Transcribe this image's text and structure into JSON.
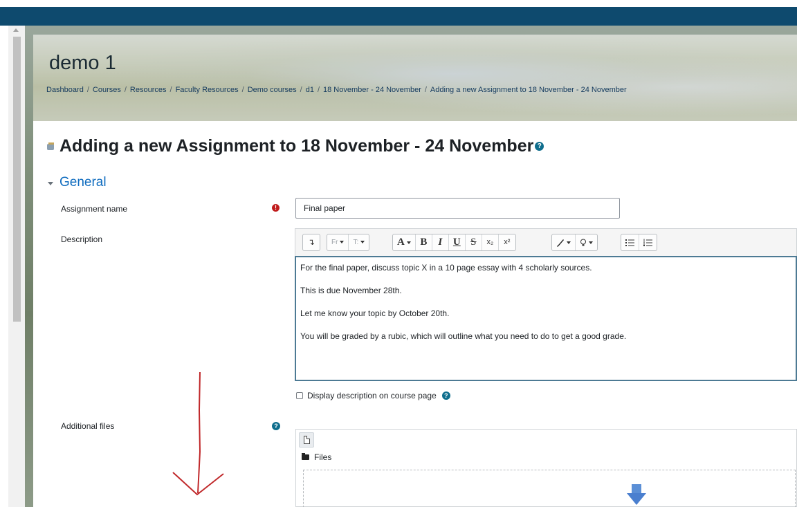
{
  "course": {
    "title": "demo 1"
  },
  "breadcrumb": [
    "Dashboard",
    "Courses",
    "Resources",
    "Faculty Resources",
    "Demo courses",
    "d1",
    "18 November - 24 November",
    "Adding a new Assignment to 18 November - 24 November"
  ],
  "page": {
    "heading": "Adding a new Assignment to 18 November - 24 November",
    "help_glyph": "?"
  },
  "section": {
    "title": "General"
  },
  "fields": {
    "assignment_name_label": "Assignment name",
    "assignment_name_value": "Final paper",
    "required_glyph": "!",
    "description_label": "Description",
    "additional_files_label": "Additional files",
    "help_glyph": "?"
  },
  "toolbar": {
    "collapse": "↴",
    "font_family": "Fr",
    "font_size": "T:",
    "font_color": "A",
    "bold": "B",
    "italic": "I",
    "underline": "U",
    "strikethrough": "S",
    "subscript": "x₂",
    "superscript": "x²"
  },
  "editor": {
    "paragraphs": [
      "For the final paper, discuss topic X in a 10 page essay with 4 scholarly sources.",
      "This is due November 28th.",
      "Let me know your topic by October 20th.",
      "You will be graded by a rubic, which will outline what you need to do to get a good grade."
    ]
  },
  "display_description": {
    "label": "Display description on course page",
    "checked": false
  },
  "filemanager": {
    "folder_label": "Files"
  },
  "colors": {
    "navbar": "#0e4a6e",
    "link": "#0f6cbf",
    "required": "#c01c1c",
    "help": "#0f6e8d",
    "annotation_arrow": "#c0282a"
  }
}
